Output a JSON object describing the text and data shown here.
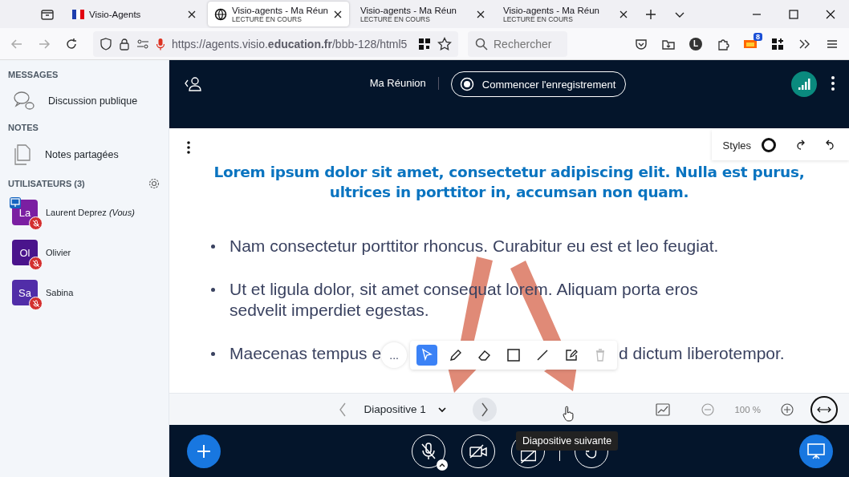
{
  "browser": {
    "tabs": [
      {
        "title": "Visio-Agents",
        "kind": "flag",
        "selected": false
      },
      {
        "title": "Visio-agents - Ma Réun",
        "subtitle": "LECTURE EN COURS",
        "kind": "globe",
        "selected": true
      },
      {
        "title": "Visio-agents - Ma Réun",
        "subtitle": "LECTURE EN COURS",
        "kind": "plain",
        "selected": false
      },
      {
        "title": "Visio-agents - Ma Réun",
        "subtitle": "LECTURE EN COURS",
        "kind": "plain",
        "selected": false
      }
    ],
    "url": "https://agents.visio.**education.fr**/bbb-128/html5",
    "search_placeholder": "Rechercher",
    "profile": "L",
    "notification_count": "8"
  },
  "sidebar": {
    "messages_title": "MESSAGES",
    "chat_item": "Discussion publique",
    "notes_title": "NOTES",
    "notes_item": "Notes partagées",
    "users_title": "UTILISATEURS (3)",
    "users": [
      {
        "initials": "La",
        "name": "Laurent Deprez *(Vous)*",
        "color": "#7b1fa2",
        "presenter": true,
        "muted": true
      },
      {
        "initials": "Ol",
        "name": "Olivier",
        "color": "#4a148c",
        "presenter": false,
        "muted": true
      },
      {
        "initials": "Sa",
        "name": "Sabina",
        "color": "#512da8",
        "presenter": false,
        "muted": true
      }
    ]
  },
  "header": {
    "meeting_title": "Ma Réunion",
    "record_button": "Commencer l'enregistrement"
  },
  "whiteboard": {
    "styles_label": "Styles",
    "more_label": "...",
    "tools": [
      {
        "kind": "select",
        "selected": true
      },
      {
        "kind": "pencil",
        "selected": false
      },
      {
        "kind": "eraser",
        "selected": false
      },
      {
        "kind": "rect",
        "selected": false
      },
      {
        "kind": "line",
        "selected": false
      },
      {
        "kind": "note",
        "selected": false
      },
      {
        "kind": "trash",
        "selected": false
      }
    ]
  },
  "slide": {
    "title": "Lorem ipsum dolor sit amet, consectetur adipiscing elit. Nulla est purus, ultrices in porttitor in, accumsan non quam.",
    "bullets": [
      {
        "text": "Nam consectetur porttitor rhoncus. Curabitur eu est et leo feugiat."
      },
      {
        "text": "Ut et ligula dolor, sit amet consequat lorem. Aliquam porta eros sedvelit imperdiet egestas."
      },
      {
        "text": "Maecenas tempus e",
        "text_after": "d dictum liberotempor."
      }
    ]
  },
  "slide_nav": {
    "slide_label": "Diapositive 1",
    "zoom": "100 %",
    "tooltip": "Diapositive suivante"
  }
}
